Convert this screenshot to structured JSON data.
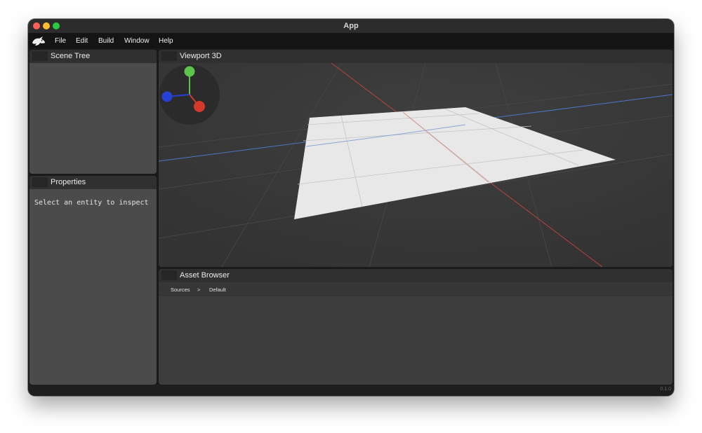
{
  "window": {
    "title": "App"
  },
  "menubar": {
    "logo_icon": "app-logo-icon",
    "items": [
      "File",
      "Edit",
      "Build",
      "Window",
      "Help"
    ]
  },
  "panels": {
    "scene_tree": {
      "title": "Scene Tree"
    },
    "properties": {
      "title": "Properties",
      "empty_hint": "Select an entity to inspect"
    },
    "viewport": {
      "title": "Viewport 3D",
      "gizmo_icon": "axis-gizmo-icon"
    },
    "asset_browser": {
      "title": "Asset Browser",
      "breadcrumb": [
        "Sources",
        ">",
        "Default"
      ]
    }
  },
  "statusbar": {
    "version": "0.1.0"
  },
  "colors": {
    "x_axis": "#d33a2c",
    "y_axis": "#5cc44b",
    "z_axis": "#2641d3",
    "panel_bg": "#4b4b4b",
    "viewport_bg": "#3a3a3a"
  }
}
